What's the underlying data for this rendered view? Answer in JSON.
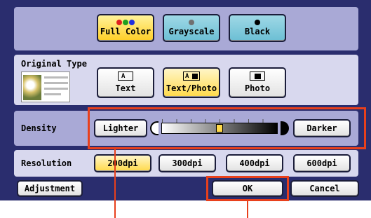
{
  "color_mode": {
    "buttons": [
      {
        "label": "Full Color",
        "selected": true
      },
      {
        "label": "Grayscale",
        "selected": false
      },
      {
        "label": "Black",
        "selected": false
      }
    ]
  },
  "original_type": {
    "label": "Original Type",
    "buttons": [
      {
        "label": "Text",
        "selected": false
      },
      {
        "label": "Text/Photo",
        "selected": true
      },
      {
        "label": "Photo",
        "selected": false
      }
    ]
  },
  "density": {
    "label": "Density",
    "lighter": "Lighter",
    "darker": "Darker",
    "level": 0.5
  },
  "resolution": {
    "label": "Resolution",
    "options": [
      {
        "label": "200dpi",
        "selected": true
      },
      {
        "label": "300dpi",
        "selected": false
      },
      {
        "label": "400dpi",
        "selected": false
      },
      {
        "label": "600dpi",
        "selected": false
      }
    ]
  },
  "footer": {
    "adjustment": "Adjustment",
    "ok": "OK",
    "cancel": "Cancel"
  },
  "colors": {
    "screen_bg": "#2a2d6e",
    "panel_bg": "#a9a9d6",
    "highlight_outline": "#e8401c",
    "selected_bg": "#ffd94a"
  }
}
